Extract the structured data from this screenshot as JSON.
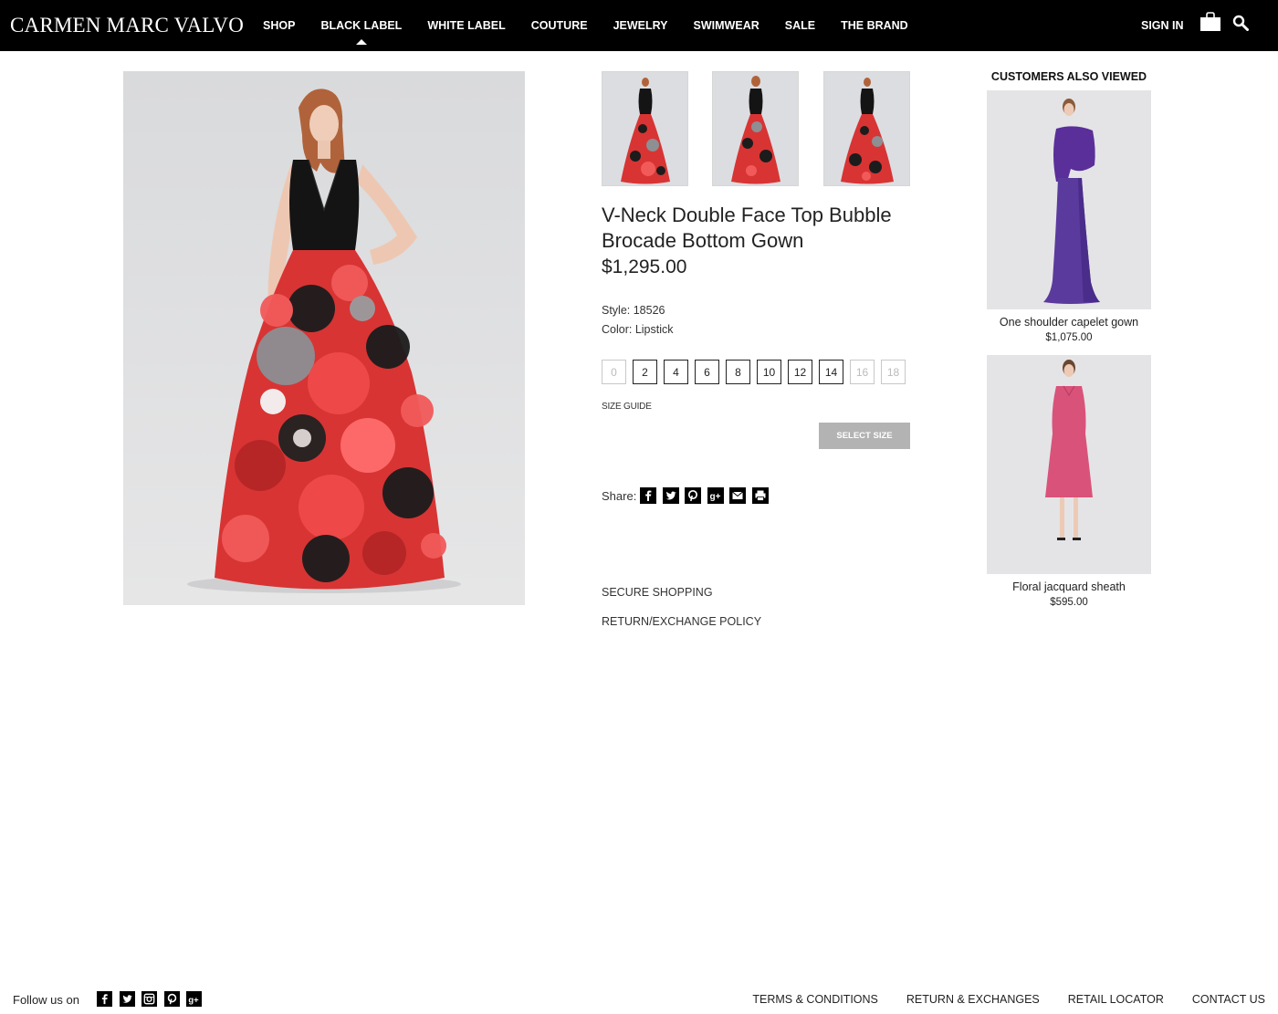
{
  "header": {
    "logo": "CARMEN MARC VALVO",
    "nav": [
      "SHOP",
      "BLACK LABEL",
      "WHITE LABEL",
      "COUTURE",
      "JEWELRY",
      "SWIMWEAR",
      "SALE",
      "THE BRAND"
    ],
    "active_nav": "BLACK LABEL",
    "sign_in": "SIGN IN",
    "icons": [
      "shopping-bag-icon",
      "search-icon"
    ]
  },
  "product": {
    "title": "V-Neck Double Face Top Bubble Brocade Bottom Gown",
    "price": "$1,295.00",
    "style": "Style: 18526",
    "color": "Color: Lipstick",
    "sizes": [
      {
        "label": "0",
        "available": false
      },
      {
        "label": "2",
        "available": true
      },
      {
        "label": "4",
        "available": true
      },
      {
        "label": "6",
        "available": true
      },
      {
        "label": "8",
        "available": true
      },
      {
        "label": "10",
        "available": true
      },
      {
        "label": "12",
        "available": true
      },
      {
        "label": "14",
        "available": true
      },
      {
        "label": "16",
        "available": false
      },
      {
        "label": "18",
        "available": false
      }
    ],
    "size_guide": "SIZE GUIDE",
    "select_size": "SELECT SIZE",
    "share_label": "Share:",
    "share_icons": [
      "facebook-icon",
      "twitter-icon",
      "pinterest-icon",
      "google-plus-icon",
      "email-icon",
      "print-icon"
    ],
    "secure_shopping": "SECURE SHOPPING",
    "return_policy": "RETURN/EXCHANGE POLICY"
  },
  "also_viewed": {
    "title": "CUSTOMERS ALSO VIEWED",
    "items": [
      {
        "name": "One shoulder capelet gown",
        "price": "$1,075.00",
        "color": "#5b3a9e"
      },
      {
        "name": "Floral jacquard sheath",
        "price": "$595.00",
        "color": "#d9527a"
      }
    ]
  },
  "footer": {
    "follow": "Follow us on",
    "social_icons": [
      "facebook-icon",
      "twitter-icon",
      "instagram-icon",
      "pinterest-icon",
      "google-plus-icon"
    ],
    "links": [
      "TERMS & CONDITIONS",
      "RETURN & EXCHANGES",
      "RETAIL LOCATOR",
      "CONTACT US"
    ]
  },
  "colors": {
    "header_bg": "#000000",
    "gown_red": "#e83a3a",
    "select_button": "#b3b3b3"
  }
}
